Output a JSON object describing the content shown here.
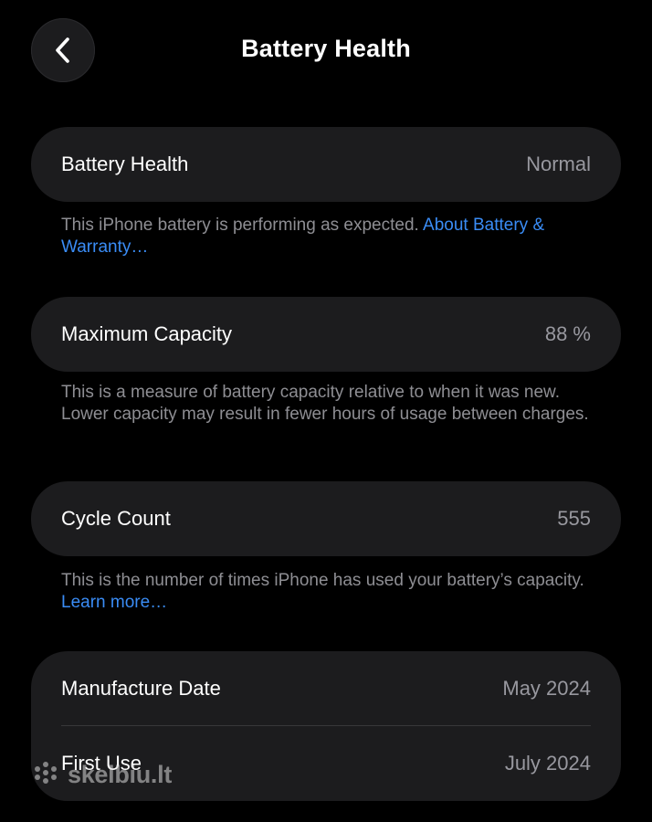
{
  "nav": {
    "title": "Battery Health",
    "back_icon": "chevron-left-icon"
  },
  "battery_health": {
    "label": "Battery Health",
    "value": "Normal",
    "note": "This iPhone battery is performing as expected. ",
    "link": "About Battery & Warranty…"
  },
  "maximum_capacity": {
    "label": "Maximum Capacity",
    "value": "88 %",
    "note": "This is a measure of battery capacity relative to when it was new. Lower capacity may result in fewer hours of usage between charges."
  },
  "cycle_count": {
    "label": "Cycle Count",
    "value": "555",
    "note": "This is the number of times iPhone has used your battery’s capacity. ",
    "link": "Learn more…"
  },
  "dates": {
    "manufacture_label": "Manufacture Date",
    "manufacture_value": "May 2024",
    "first_use_label": "First Use",
    "first_use_value": "July 2024"
  },
  "watermark": {
    "text": "skelbiu.lt"
  },
  "colors": {
    "background": "#000000",
    "card": "#1c1c1e",
    "secondary_text": "#8e8e93",
    "link": "#3a8cf5"
  }
}
